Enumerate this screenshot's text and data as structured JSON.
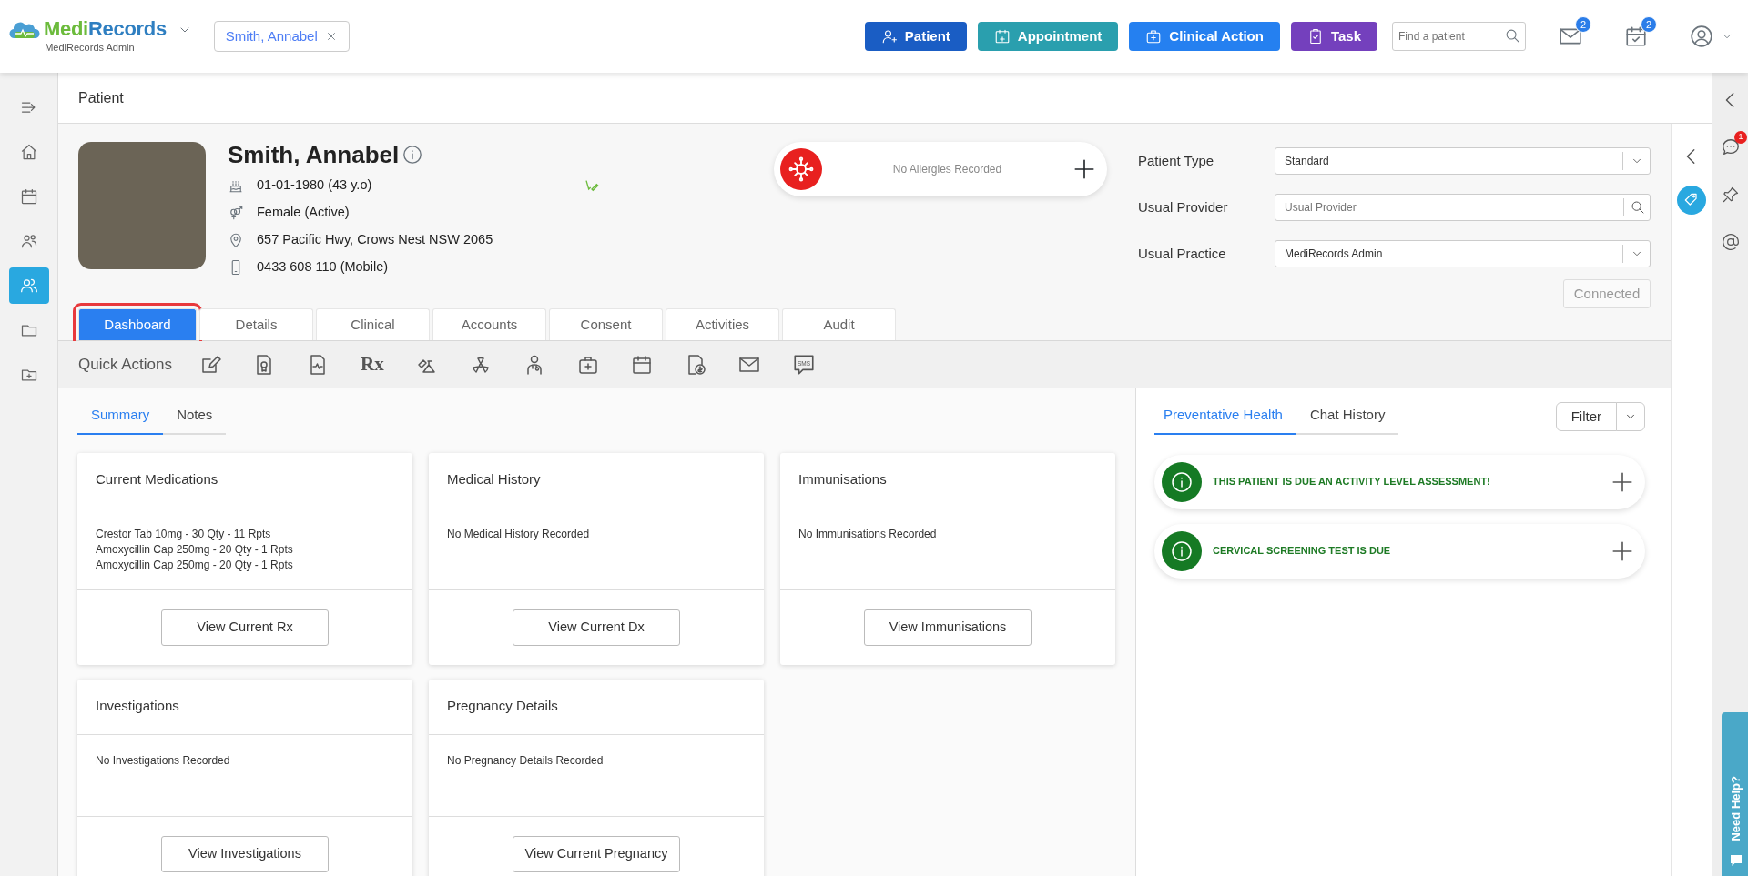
{
  "header": {
    "logo_parts": [
      "Medi",
      "Records"
    ],
    "org": "MediRecords Admin",
    "patient_chip": "Smith, Annabel",
    "buttons": [
      {
        "label": "Patient",
        "color": "#1a5dc4"
      },
      {
        "label": "Appointment",
        "color": "#2a9fae"
      },
      {
        "label": "Clinical Action",
        "color": "#2580f0"
      },
      {
        "label": "Task",
        "color": "#7440bd"
      }
    ],
    "search": {
      "placeholder": "Find a patient"
    },
    "mail_badge": "2",
    "tasks_badge": "2"
  },
  "nav_items": [
    {
      "selected": false
    },
    {
      "selected": false
    },
    {
      "selected": false
    },
    {
      "selected": false
    },
    {
      "selected": true
    },
    {
      "selected": false
    },
    {
      "selected": false
    }
  ],
  "page_title": "Patient",
  "patient": {
    "name": "Smith, Annabel",
    "dob": "01-01-1980 (43 y.o)",
    "gender": "Female (Active)",
    "address": "657 Pacific Hwy, Crows Nest NSW 2065",
    "phone": "0433 608 110 (Mobile)"
  },
  "allergies": {
    "text": "No Allergies Recorded"
  },
  "fields": [
    {
      "label": "Patient Type",
      "kind": "select",
      "value": "Standard"
    },
    {
      "label": "Usual Provider",
      "kind": "search",
      "placeholder": "Usual Provider"
    },
    {
      "label": "Usual Practice",
      "kind": "select",
      "value": "MediRecords Admin"
    }
  ],
  "connected_button": {
    "label": "Connected",
    "disabled": true
  },
  "tabs": [
    {
      "label": "Dashboard",
      "selected": true,
      "highlighted": true
    },
    {
      "label": "Details",
      "selected": false,
      "highlighted": false
    },
    {
      "label": "Clinical",
      "selected": false,
      "highlighted": false
    },
    {
      "label": "Accounts",
      "selected": false,
      "highlighted": false
    },
    {
      "label": "Consent",
      "selected": false,
      "highlighted": false
    },
    {
      "label": "Activities",
      "selected": false,
      "highlighted": false
    },
    {
      "label": "Audit",
      "selected": false,
      "highlighted": false
    }
  ],
  "quick_actions": {
    "title": "Quick Actions",
    "items": [
      {
        "kind": "icon"
      },
      {
        "kind": "icon"
      },
      {
        "kind": "icon"
      },
      {
        "kind": "glyph",
        "label": "Rx"
      },
      {
        "kind": "icon"
      },
      {
        "kind": "icon"
      },
      {
        "kind": "icon"
      },
      {
        "kind": "icon"
      },
      {
        "kind": "icon"
      },
      {
        "kind": "icon"
      },
      {
        "kind": "icon"
      },
      {
        "kind": "sms",
        "label": "SMS"
      }
    ]
  },
  "summary_tabs": [
    {
      "label": "Summary",
      "selected": true
    },
    {
      "label": "Notes",
      "selected": false
    }
  ],
  "cards": [
    {
      "title": "Current Medications",
      "lines": [
        "Crestor Tab 10mg - 30 Qty - 11 Rpts",
        "Amoxycillin Cap 250mg - 20 Qty - 1 Rpts",
        "Amoxycillin Cap 250mg - 20 Qty - 1 Rpts"
      ],
      "button": "View Current Rx"
    },
    {
      "title": "Medical History",
      "lines": [
        "No Medical History Recorded"
      ],
      "button": "View Current Dx"
    },
    {
      "title": "Immunisations",
      "lines": [
        "No Immunisations Recorded"
      ],
      "button": "View Immunisations"
    },
    {
      "title": "Investigations",
      "lines": [
        "No Investigations Recorded"
      ],
      "button": "View Investigations"
    },
    {
      "title": "Pregnancy Details",
      "lines": [
        "No Pregnancy Details Recorded"
      ],
      "button": "View Current Pregnancy"
    }
  ],
  "right_panel": {
    "tabs": [
      {
        "label": "Preventative Health",
        "selected": true
      },
      {
        "label": "Chat History",
        "selected": false
      }
    ],
    "filter": "Filter",
    "alerts": [
      {
        "text": "THIS PATIENT IS DUE AN ACTIVITY LEVEL ASSESSMENT!"
      },
      {
        "text": "CERVICAL SCREENING TEST IS DUE"
      }
    ]
  },
  "side_rail": {
    "chat_badge": "1",
    "need_help": "Need Help?"
  }
}
